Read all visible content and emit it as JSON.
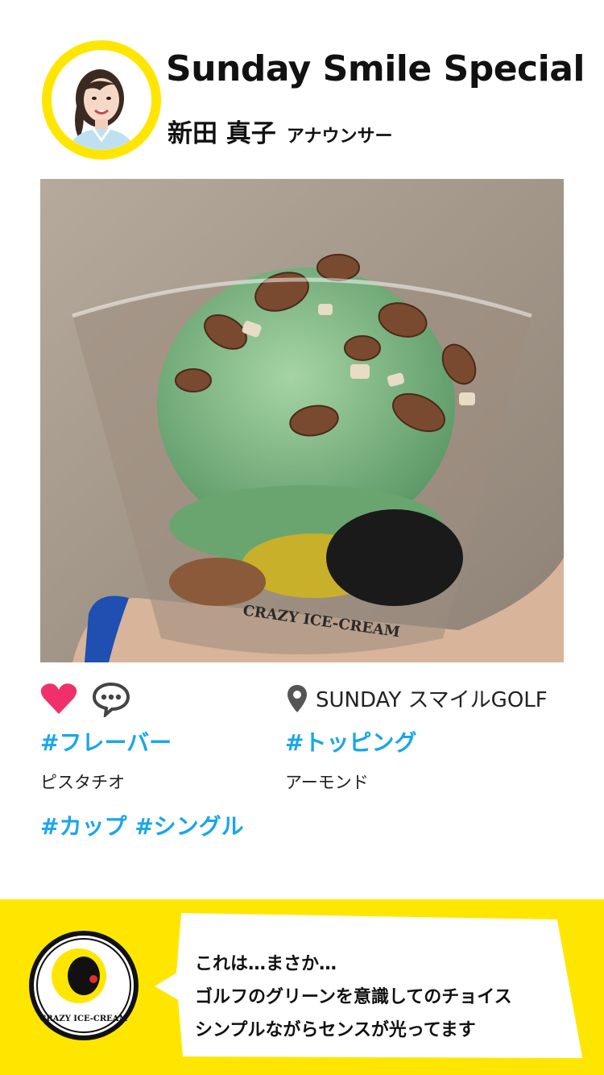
{
  "header": {
    "title": "Sunday Smile Special",
    "name": "新田 真子",
    "role": "アナウンサー"
  },
  "post": {
    "location": "SUNDAY スマイルGOLF",
    "flavor_tag": "#フレーバー",
    "flavor_value": "ピスタチオ",
    "topping_tag": "#トッピング",
    "topping_value": "アーモンド",
    "style_tags": "#カップ #シングル",
    "cup_print": "CRAZY ICE-CREAM"
  },
  "comment": {
    "line1": "これは…まさか…",
    "line2": "ゴルフのグリーンを意識してのチョイス",
    "line3": "シンプルながらセンスが光ってます",
    "logo_text": "CRAZY ICE-CREAM"
  },
  "colors": {
    "accent_yellow": "#ffe600",
    "hashtag_blue": "#1aa6ea",
    "heart_pink": "#f0306a"
  },
  "icons": [
    "heart-icon",
    "comment-icon",
    "location-pin-icon"
  ]
}
